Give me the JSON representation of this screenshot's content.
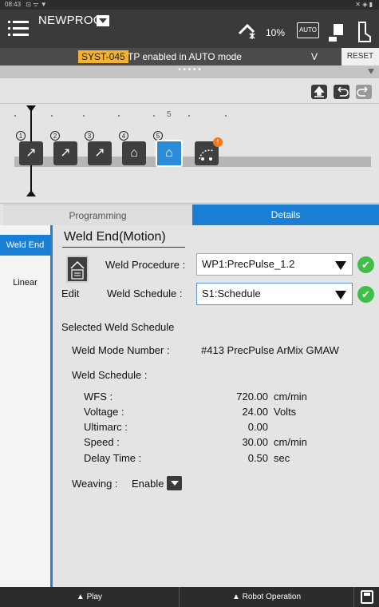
{
  "status_bar": {
    "time": "08:43",
    "icons": "⊡ ᯤ ▼",
    "right_icons": "✕ ◈ ▮"
  },
  "header": {
    "program_name": "NEWPROG",
    "override": "10%",
    "auto_label": "AUTO"
  },
  "alarm": {
    "code": "SYST-045",
    "message": "TP enabled in AUTO mode",
    "expand": "V",
    "reset_label": "RESET"
  },
  "dots": "• • • • •",
  "timeline": {
    "ruler_label": "5",
    "nodes": [
      {
        "num": "1",
        "glyph": "↗",
        "selected": false
      },
      {
        "num": "2",
        "glyph": "↗",
        "selected": false
      },
      {
        "num": "3",
        "glyph": "↗",
        "selected": false
      },
      {
        "num": "4",
        "glyph": "⌂",
        "selected": false
      },
      {
        "num": "5",
        "glyph": "⌂",
        "selected": true
      }
    ],
    "alarm_badge": "!"
  },
  "tabs": {
    "programming": "Programming",
    "details": "Details"
  },
  "sidebar": {
    "items": [
      {
        "label": "Weld End",
        "active": true
      },
      {
        "label": "Linear",
        "active": false
      }
    ]
  },
  "detail": {
    "title": "Weld End(Motion)",
    "edit_label": "Edit",
    "procedure_label": "Weld Procedure :",
    "procedure_value": "WP1:PrecPulse_1.2",
    "schedule_label": "Weld Schedule :",
    "schedule_value": "S1:Schedule",
    "selected_heading": "Selected Weld Schedule",
    "mode_label": "Weld Mode Number :",
    "mode_value": "#413 PrecPulse ArMix GMAW",
    "schedule_heading": "Weld Schedule :",
    "params": [
      {
        "name": "WFS :",
        "value": "720.00",
        "unit": "cm/min"
      },
      {
        "name": "Voltage :",
        "value": "24.00",
        "unit": "Volts"
      },
      {
        "name": "Ultimarc :",
        "value": "0.00",
        "unit": ""
      },
      {
        "name": "Speed :",
        "value": "30.00",
        "unit": "cm/min"
      },
      {
        "name": "Delay Time :",
        "value": "0.50",
        "unit": "sec"
      }
    ],
    "weaving_label": "Weaving :",
    "weaving_value": "Enable"
  },
  "bottom": {
    "play": "▲ Play",
    "robot_operation": "▲ Robot Operation"
  },
  "colors": {
    "accent": "#1a7fd4",
    "alarm": "#f3b233",
    "ok": "#3fbf4a"
  }
}
